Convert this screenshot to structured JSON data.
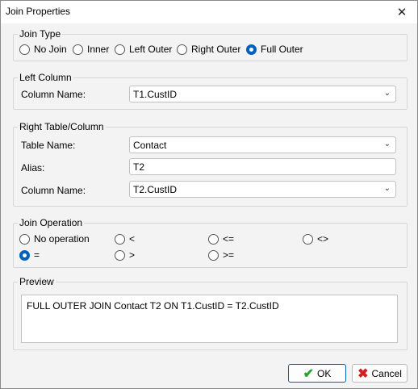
{
  "window": {
    "title": "Join Properties",
    "close_glyph": "✕"
  },
  "join_type": {
    "legend": "Join Type",
    "options": [
      "No Join",
      "Inner",
      "Left Outer",
      "Right Outer",
      "Full Outer"
    ],
    "selected": "Full Outer"
  },
  "left_column": {
    "legend": "Left Column",
    "column_label": "Column Name:",
    "column_value": "T1.CustID"
  },
  "right_table": {
    "legend": "Right Table/Column",
    "table_label": "Table Name:",
    "table_value": "Contact",
    "alias_label": "Alias:",
    "alias_value": "T2",
    "column_label": "Column Name:",
    "column_value": "T2.CustID"
  },
  "join_operation": {
    "legend": "Join Operation",
    "options": [
      "No operation",
      "<",
      "<=",
      "<>",
      "=",
      ">",
      ">="
    ],
    "selected": "="
  },
  "preview": {
    "legend": "Preview",
    "text": "FULL OUTER JOIN Contact T2 ON T1.CustID = T2.CustID"
  },
  "buttons": {
    "ok_label": "OK",
    "cancel_label": "Cancel"
  },
  "icons": {
    "ok": "checkmark-icon",
    "cancel": "x-icon",
    "dropdown": "chevron-down-icon"
  },
  "colors": {
    "accent": "#0060c0",
    "ok_green": "#2aa32a",
    "cancel_red": "#d62020"
  }
}
